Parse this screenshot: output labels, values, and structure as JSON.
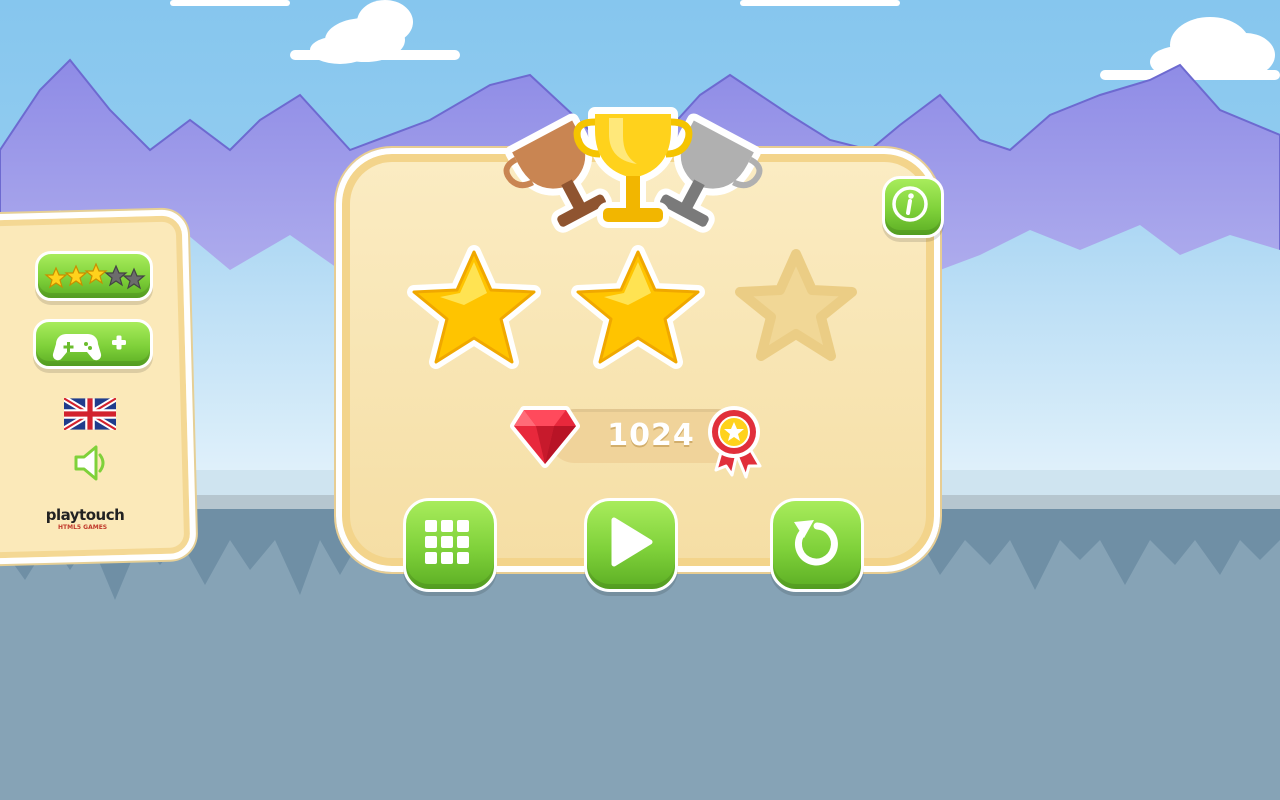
{
  "game": {
    "level_result": {
      "stars_earned": 2,
      "stars_total": 3,
      "score": "1024"
    },
    "trophies": [
      "bronze-trophy",
      "gold-trophy",
      "silver-trophy"
    ],
    "side_menu": {
      "rating_stars": 3,
      "rating_total": 5,
      "language": "English (UK flag)",
      "sound_icon": "speaker-icon"
    },
    "brand": {
      "name": "playtouch",
      "sub": "HTML5 GAMES"
    },
    "buttons": {
      "menu": "grid-icon",
      "play": "play-icon",
      "retry": "retry-icon",
      "info": "info-icon",
      "more_games": "gamepad-plus-icon"
    },
    "colors": {
      "sky": "#8ccbef",
      "mountains": "#9a97e8",
      "panel": "#fbe9b9",
      "button_green": "#7fd13a",
      "star_gold": "#ffd21c",
      "gem_red": "#e8283c",
      "ground": "#86a3b6"
    }
  }
}
